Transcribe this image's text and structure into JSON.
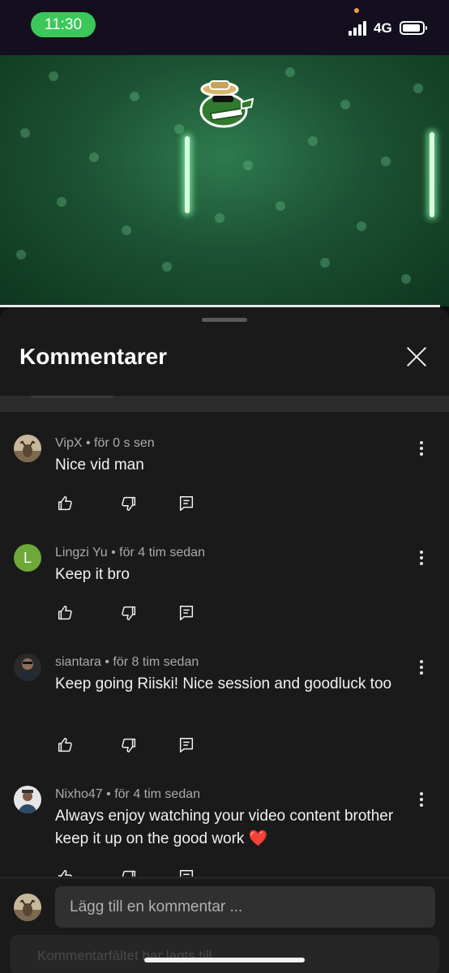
{
  "status_bar": {
    "time": "11:30",
    "network": "4G",
    "battery_level": 0.8,
    "signal_bars": 4
  },
  "sheet": {
    "title": "Kommentarer",
    "close_icon": "close-icon"
  },
  "comments": [
    {
      "user": "VipX",
      "meta": "VipX • för 0 s sen",
      "text": "Nice vid man",
      "avatar": "deer-avatar"
    },
    {
      "user": "Lingzi Yu",
      "meta": "Lingzi Yu • för 4 tim sedan",
      "text": "Keep it bro",
      "avatar_letter": "L",
      "avatar_color": "#6ea83a"
    },
    {
      "user": "siantara",
      "meta": "siantara • för 8 tim sedan",
      "text": "Keep going Riiski! Nice session and goodluck too",
      "avatar": "photo-avatar"
    },
    {
      "user": "Nixho47",
      "meta": "Nixho47 • för 4 tim sedan",
      "text": "Always enjoy watching your video content brother keep it up on the good work ❤️",
      "avatar": "photo-avatar"
    }
  ],
  "input": {
    "placeholder": "Lägg till en kommentar ..."
  },
  "faded_text": "Kommentarfältet har lagts till"
}
